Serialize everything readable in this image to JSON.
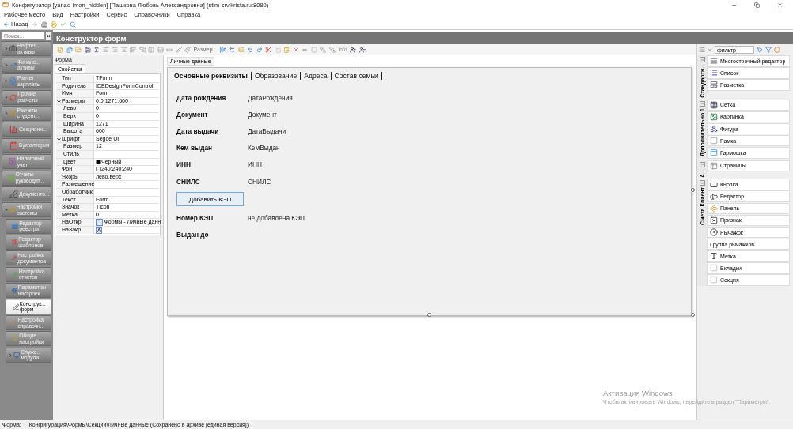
{
  "window": {
    "title": "Конфигуратор [yanao-imon_hidden] [Пашкова Любовь Александровна] (stim-srv.krista.ru:8080)"
  },
  "menu": [
    "Рабочее место",
    "Вид",
    "Настройки",
    "Сервис",
    "Справочники",
    "Справка"
  ],
  "toolbar": {
    "back": "Назад"
  },
  "sidebar": {
    "search_placeholder": "Поиск...",
    "close": "×",
    "items": [
      {
        "label": "Нефтег... активы",
        "expanded": false,
        "selected": false
      },
      {
        "label": "Финанс... активы",
        "expanded": false,
        "selected": false
      },
      {
        "label": "Расчет зарплаты",
        "expanded": false,
        "selected": false
      },
      {
        "label": "Прочие расчеты",
        "expanded": false,
        "selected": false
      },
      {
        "label": "Расчеты студент...",
        "expanded": false,
        "selected": false
      },
      {
        "label": "Секционн...",
        "selected": false
      },
      {
        "label": "Бухгалтерия",
        "selected": false
      },
      {
        "label": "Налоговый учет",
        "selected": false
      },
      {
        "label": "Отчеты руководит...",
        "selected": false
      },
      {
        "label": "Документо...",
        "selected": false
      },
      {
        "label": "Настройки системы",
        "expanded": true,
        "selected": false,
        "children": [
          {
            "label": "Редактор реестра",
            "selected": false
          },
          {
            "label": "Редактор шаблонов",
            "selected": false
          },
          {
            "label": "Настройка документов",
            "selected": false
          },
          {
            "label": "Настройка отчетов",
            "selected": false
          },
          {
            "label": "Параметры настроек",
            "selected": false
          },
          {
            "label": "Конструк... форм",
            "selected": true
          },
          {
            "label": "Настройка справочн...",
            "selected": false
          },
          {
            "label": "Общие настройки",
            "selected": false
          },
          {
            "label": "Служе... модули",
            "expanded": false,
            "selected": false
          }
        ]
      }
    ]
  },
  "header": {
    "title": "Конструктор форм"
  },
  "designer_toolbar": {
    "size_label": "Размер...",
    "info_label": "info"
  },
  "properties": {
    "title": "Форма",
    "tab": "Свойства",
    "rows": [
      {
        "name": "Тип",
        "value": "TForm"
      },
      {
        "name": "Родитель",
        "value": "IDEDesignFormControl"
      },
      {
        "name": "Имя",
        "value": "Form"
      },
      {
        "name": "Размеры",
        "value": "0,0,1271,600",
        "expanded": true,
        "children": [
          {
            "name": "Лево",
            "value": "0"
          },
          {
            "name": "Верх",
            "value": "0"
          },
          {
            "name": "Ширина",
            "value": "1271"
          },
          {
            "name": "Высота",
            "value": "600"
          }
        ]
      },
      {
        "name": "Шрифт",
        "value": "Segoe UI",
        "expanded": true,
        "children": [
          {
            "name": "Размер",
            "value": "12"
          },
          {
            "name": "Стиль"
          },
          {
            "name": "Цвет",
            "value": "Черный",
            "color": "#000000"
          }
        ]
      },
      {
        "name": "Фон",
        "value": "240;240;240",
        "color": "#f0f0f0"
      },
      {
        "name": "Якорь",
        "value": "лево,верх"
      },
      {
        "name": "Размещение"
      },
      {
        "name": "Обработчик"
      },
      {
        "name": "Текст",
        "value": "Form"
      },
      {
        "name": "Значок",
        "value": "TIcon"
      },
      {
        "name": "Метка",
        "value": "0"
      },
      {
        "name": "НаОткр",
        "value": "Формы - Личные данн",
        "button": "..."
      },
      {
        "name": "НаЗакр",
        "button": "A"
      }
    ]
  },
  "canvas": {
    "page_tab": "Личные данные",
    "tabs": [
      {
        "label": "Основные реквизиты",
        "selected": true
      },
      {
        "label": "Образование",
        "selected": false
      },
      {
        "label": "Адреса",
        "selected": false
      },
      {
        "label": "Состав семьи",
        "selected": false
      }
    ],
    "fields": [
      {
        "label": "Дата рождения",
        "value": "ДатаРождения"
      },
      {
        "label": "Документ",
        "value": "Документ"
      },
      {
        "label": "Дата выдачи",
        "value": "ДатаВыдачи"
      },
      {
        "label": "Кем выдан",
        "value": "КемВыдан"
      },
      {
        "label": "ИНН",
        "value": "ИНН"
      },
      {
        "label": "СНИЛС",
        "value": "СНИЛС"
      }
    ],
    "button": "Добавить КЭП",
    "fields_after": [
      {
        "label": "Номер КЭП",
        "value": "не добавлена КЭП"
      },
      {
        "label": "Выдан до"
      }
    ]
  },
  "palette": {
    "filter": "фильтр",
    "groups": [
      {
        "title": "Стандартн...",
        "expanded": true,
        "items": [
          {
            "label": "Многострочный редактор"
          },
          {
            "label": "Список"
          },
          {
            "label": "Разметка"
          }
        ]
      },
      {
        "title": "Дополнительно 1",
        "expanded": true,
        "items": [
          {
            "label": "Сетка"
          },
          {
            "label": "Картинка"
          },
          {
            "label": "Фигура"
          },
          {
            "label": "Рамка"
          },
          {
            "label": "Гармошка"
          }
        ]
      },
      {
        "title": "А...",
        "expanded": true,
        "items": [
          {
            "label": "Страницы"
          }
        ]
      },
      {
        "title": "Смета Клиент",
        "expanded": true,
        "items": [
          {
            "label": "Кнопка"
          },
          {
            "label": "Редактор"
          },
          {
            "label": "Панель"
          },
          {
            "label": "Признак"
          },
          {
            "label": "Рычажок"
          },
          {
            "label": "Группа рычажков",
            "kind": "plain"
          },
          {
            "label": "Метка"
          },
          {
            "label": "Вкладки"
          },
          {
            "label": "Секция"
          }
        ]
      }
    ]
  },
  "activation": {
    "title": "Активация Windows",
    "text": "Чтобы активировать Windows, перейдите в раздел \"Параметры\"."
  },
  "status_bar": {
    "label": "Форма:",
    "path": "Конфигурация\\Формы\\Секции\\Личные данные (Сохранено в архиве [единая версия])"
  }
}
